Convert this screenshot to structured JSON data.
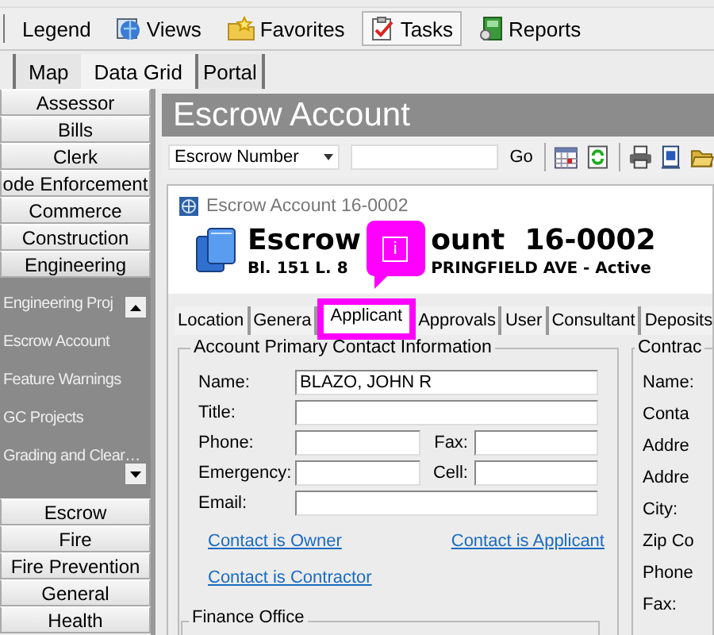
{
  "toolbar": {
    "items": [
      {
        "label": "Legend",
        "pressed": false
      },
      {
        "label": "Views",
        "pressed": false
      },
      {
        "label": "Favorites",
        "pressed": false
      },
      {
        "label": "Tasks",
        "pressed": true
      },
      {
        "label": "Reports",
        "pressed": false
      }
    ]
  },
  "view_tabs": [
    {
      "label": "Map",
      "selected": false
    },
    {
      "label": "Data Grid",
      "selected": true
    },
    {
      "label": "Portal",
      "selected": false
    }
  ],
  "sidebar": {
    "items": [
      {
        "label": "Assessor"
      },
      {
        "label": "Bills"
      },
      {
        "label": "Clerk"
      },
      {
        "label": "ode Enforcement"
      },
      {
        "label": "Commerce"
      },
      {
        "label": "Construction"
      },
      {
        "label": "Engineering",
        "children": [
          {
            "label": "Engineering Proj"
          },
          {
            "label": "Escrow Account"
          },
          {
            "label": "Feature Warnings"
          },
          {
            "label": "GC Projects"
          },
          {
            "label": "Grading and Clear…"
          }
        ]
      },
      {
        "label": "Escrow"
      },
      {
        "label": "Fire"
      },
      {
        "label": "Fire Prevention"
      },
      {
        "label": "General"
      },
      {
        "label": "Health"
      }
    ]
  },
  "panel": {
    "title": "Escrow Account",
    "search": {
      "field": "Escrow Number",
      "go": "Go"
    }
  },
  "form": {
    "header": "Escrow Account 16-0002",
    "title_parts": [
      "Escrow",
      "ount  16-0002"
    ],
    "subtitle_parts": [
      "Bl. 151 L. 8",
      "PRINGFIELD AVE - Active"
    ],
    "callout": {
      "icon": "i"
    },
    "tabs": [
      {
        "label": "Location",
        "selected": false
      },
      {
        "label": "Genera",
        "selected": false
      },
      {
        "label": "Applicant",
        "selected": true
      },
      {
        "label": "Approvals",
        "selected": false
      },
      {
        "label": "User",
        "selected": false
      },
      {
        "label": "Consultant",
        "selected": false
      },
      {
        "label": "Deposits",
        "selected": false
      }
    ],
    "contact_group": {
      "legend": "Account Primary Contact Information",
      "rows": [
        [
          {
            "label": "Name:",
            "value": "BLAZO, JOHN R"
          }
        ],
        [
          {
            "label": "Title:"
          }
        ],
        [
          {
            "label": "Phone:"
          },
          {
            "label": "Fax:"
          }
        ],
        [
          {
            "label": "Emergency:"
          },
          {
            "label": "Cell:"
          }
        ],
        [
          {
            "label": "Email:"
          }
        ]
      ],
      "links": [
        [
          "Contact is Owner",
          "Contact is Applicant"
        ],
        [
          "Contact is Contractor"
        ]
      ]
    },
    "contractor_group": {
      "legend": "Contrac",
      "labels": [
        "Name:",
        "Conta",
        "Addre",
        "Addre",
        "City:",
        "Zip Co",
        "Phone",
        "Fax:"
      ]
    },
    "finance_group": {
      "legend": "Finance Office"
    }
  }
}
